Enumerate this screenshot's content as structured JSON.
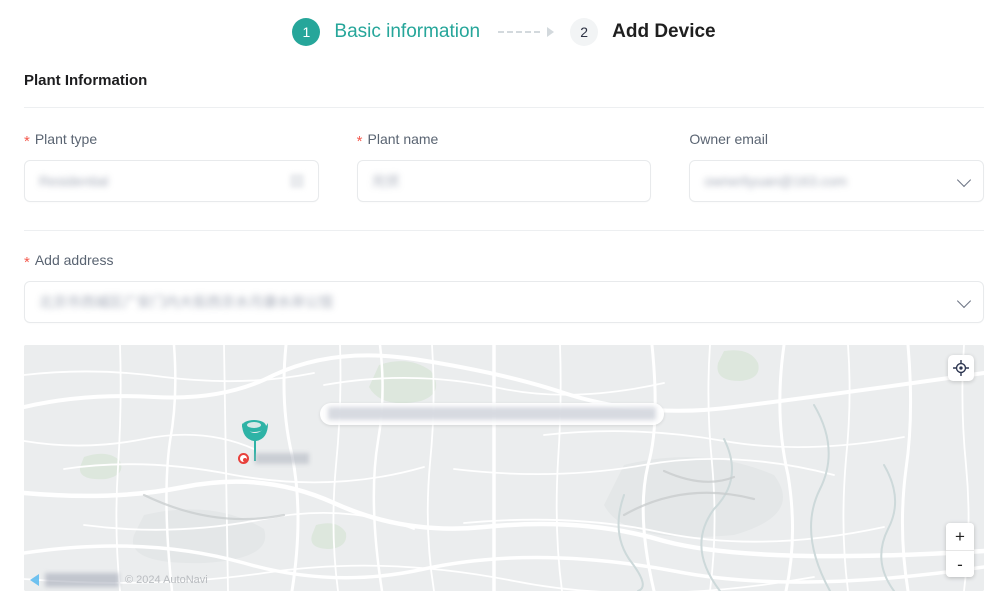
{
  "stepper": {
    "steps": [
      {
        "number": "1",
        "label": "Basic information",
        "state": "active"
      },
      {
        "number": "2",
        "label": "Add Device",
        "state": "inactive"
      }
    ],
    "connector_icon": "dashed-arrow-right-icon",
    "active_color": "#26a69a",
    "inactive_circle_color": "#f2f4f5"
  },
  "section": {
    "title": "Plant Information"
  },
  "fields": {
    "plant_type": {
      "label": "Plant type",
      "required": true,
      "required_mark": "*",
      "value": "Residential",
      "redacted": true,
      "control": "select",
      "icon": "chevron-down-icon"
    },
    "plant_name": {
      "label": "Plant name",
      "required": true,
      "required_mark": "*",
      "value": "光伏",
      "redacted": true,
      "control": "text"
    },
    "owner_email": {
      "label": "Owner email",
      "required": false,
      "required_mark": "",
      "value": "ownerliyuan@163.com",
      "redacted": true,
      "control": "select",
      "icon": "chevron-down-icon"
    },
    "add_address": {
      "label": "Add address",
      "required": true,
      "required_mark": "*",
      "value": "北京市西城区广安门内大街西京水月康水岸公馆",
      "redacted": true,
      "control": "select",
      "icon": "chevron-down-icon"
    }
  },
  "map": {
    "tooltip_text": "北京市西城区广安门内大街西京水月康水岸公馆",
    "tooltip_redacted": true,
    "marker_color": "#2eb3a6",
    "marker_icon": "location-pin-icon",
    "poi_label": "北京西站",
    "poi_redacted": true,
    "poi_icon": "poi-dot-icon",
    "locate_button": {
      "icon": "crosshair-locate-icon",
      "label": ""
    },
    "zoom_in": {
      "icon": "plus-icon",
      "label": "+"
    },
    "zoom_out": {
      "icon": "minus-icon",
      "label": "-"
    },
    "attribution": "© 2024 AutoNavi",
    "attribution_logo": "autonavi-logo",
    "base_color": "#ebedee",
    "road_color": "#ffffff"
  }
}
